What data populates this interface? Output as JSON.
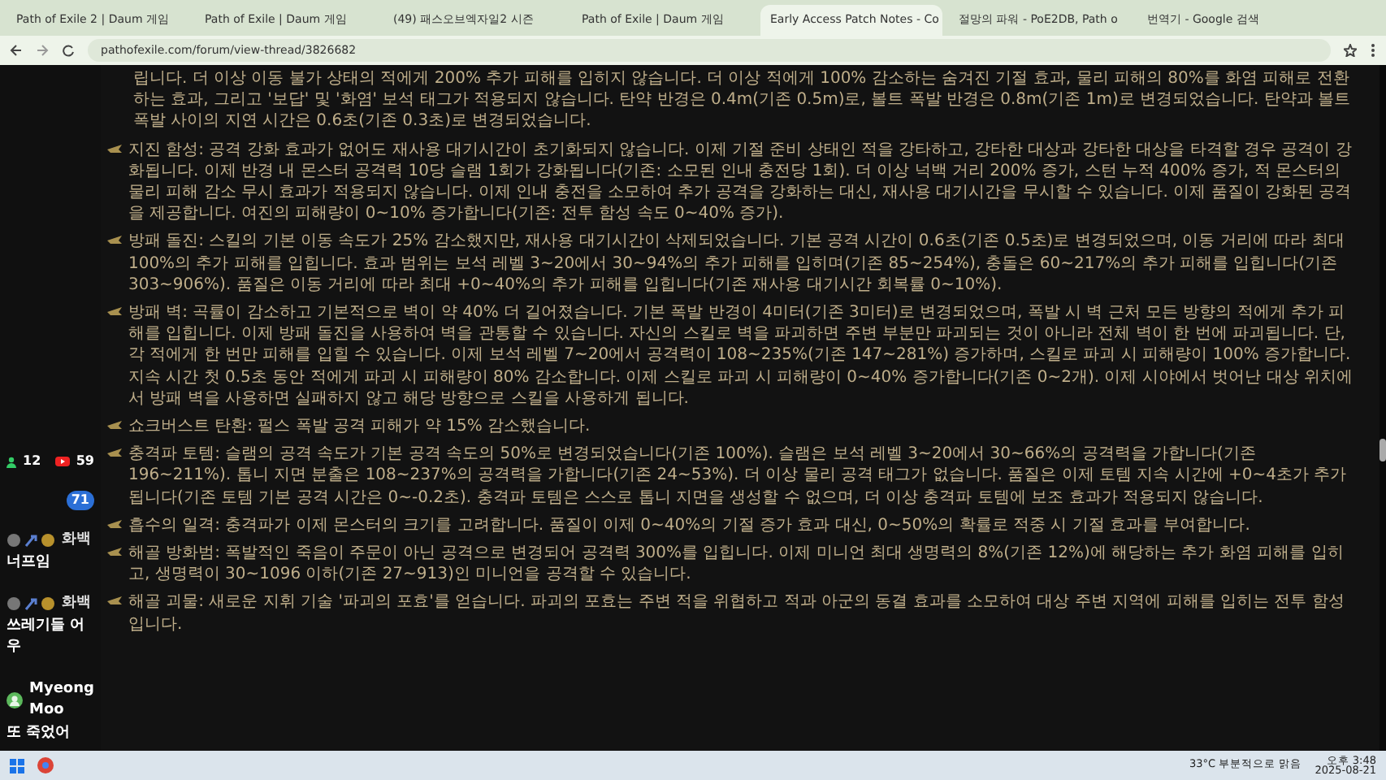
{
  "browser": {
    "tabs": [
      {
        "title": "Path of Exile 2 | Daum 게임",
        "selected": false
      },
      {
        "title": "Path of Exile | Daum 게임",
        "selected": false
      },
      {
        "title": "(49) 패스오브엑자일2 시즌",
        "selected": false
      },
      {
        "title": "Path of Exile | Daum 게임",
        "selected": false
      },
      {
        "title": "Early Access Patch Notes - Co",
        "selected": true
      },
      {
        "title": "절망의 파워 - PoE2DB, Path o",
        "selected": false
      },
      {
        "title": "번역기 - Google 검색",
        "selected": false
      }
    ],
    "url": "pathofexile.com/forum/view-thread/3826682"
  },
  "page": {
    "intro": "립니다. 더 이상 이동 불가 상태의 적에게 200% 추가 피해를 입히지 않습니다. 더 이상 적에게 100% 감소하는 숨겨진 기절 효과, 물리 피해의 80%를 화염 피해로 전환하는 효과, 그리고 '보답' 및 '화염' 보석 태그가 적용되지 않습니다. 탄약 반경은 0.4m(기존 0.5m)로, 볼트 폭발 반경은 0.8m(기존 1m)로 변경되었습니다. 탄약과 볼트 폭발 사이의 지연 시간은 0.6초(기존 0.3초)로 변경되었습니다.",
    "items": [
      {
        "text": "지진 함성: 공격 강화 효과가 없어도 재사용 대기시간이 초기화되지 않습니다. 이제 기절 준비 상태인 적을 강타하고, 강타한 대상과 강타한 대상을 타격할 경우 공격이 강화됩니다. 이제 반경 내 몬스터 공격력 10당 슬램 1회가 강화됩니다(기존: 소모된 인내 충전당 1회). 더 이상 넉백 거리 200% 증가, 스턴 누적 400% 증가, 적 몬스터의 물리 피해 감소 무시 효과가 적용되지 않습니다. 이제 인내 충전을 소모하여 추가 공격을 강화하는 대신, 재사용 대기시간을 무시할 수 있습니다. 이제 품질이 강화된 공격을 제공합니다. 여진의 피해량이 0~10% 증가합니다(기존: 전투 함성 속도 0~40% 증가)."
      },
      {
        "text": "방패 돌진: 스킬의 기본 이동 속도가 25% 감소했지만, 재사용 대기시간이 삭제되었습니다. 기본 공격 시간이 0.6초(기존 0.5초)로 변경되었으며, 이동 거리에 따라 최대 100%의 추가 피해를 입힙니다. 효과 범위는 보석 레벨 3~20에서 30~94%의 추가 피해를 입히며(기존 85~254%), 충돌은 60~217%의 추가 피해를 입힙니다(기존 303~906%). 품질은 이동 거리에 따라 최대 +0~40%의 추가 피해를 입힙니다(기존 재사용 대기시간 회복률 0~10%)."
      },
      {
        "text": "방패 벽: 곡률이 감소하고 기본적으로 벽이 약 40% 더 길어졌습니다. 기본 폭발 반경이 4미터(기존 3미터)로 변경되었으며, 폭발 시 벽 근처 모든 방향의 적에게 추가 피해를 입힙니다. 이제 방패 돌진을 사용하여 벽을 관통할 수 있습니다. 자신의 스킬로 벽을 파괴하면 주변 부분만 파괴되는 것이 아니라 전체 벽이 한 번에 파괴됩니다. 단, 각 적에게 한 번만 피해를 입힐 수 있습니다. 이제 보석 레벨 7~20에서 공격력이 108~235%(기존 147~281%) 증가하며, 스킬로 파괴 시 피해량이 100% 증가합니다. 지속 시간 첫 0.5초 동안 적에게 파괴 시 피해량이 80% 감소합니다. 이제 스킬로 파괴 시 피해량이 0~40% 증가합니다(기존 0~2개). 이제 시야에서 벗어난 대상 위치에서 방패 벽을 사용하면 실패하지 않고 해당 방향으로 스킬을 사용하게 됩니다."
      },
      {
        "text": "쇼크버스트 탄환: 펄스 폭발 공격 피해가 약 15% 감소했습니다."
      },
      {
        "text": "충격파 토템: 슬램의 공격 속도가 기본 공격 속도의 50%로 변경되었습니다(기존 100%). 슬램은 보석 레벨 3~20에서 30~66%의 공격력을 가합니다(기존 196~211%). 톱니 지면 분출은 108~237%의 공격력을 가합니다(기존 24~53%). 더 이상 물리 공격 태그가 없습니다. 품질은 이제 토템 지속 시간에 +0~4초가 추가됩니다(기존 토템 기본 공격 시간은 0~-0.2초). 충격파 토템은 스스로 톱니 지면을 생성할 수 없으며, 더 이상 충격파 토템에 보조 효과가 적용되지 않습니다."
      },
      {
        "text": "흡수의 일격: 충격파가 이제 몬스터의 크기를 고려합니다. 품질이 이제 0~40%의 기절 증가 효과 대신, 0~50%의 확률로 적중 시 기절 효과를 부여합니다."
      },
      {
        "text": "해골 방화범: 폭발적인 죽음이 주문이 아닌 공격으로 변경되어 공격력 300%를 입힙니다. 이제 미니언 최대 생명력의 8%(기존 12%)에 해당하는 추가 화염 피해를 입히고, 생명력이 30~1096 이하(기존 27~913)인 미니언을 공격할 수 있습니다."
      },
      {
        "text": "해골 괴물: 새로운 지휘 기술 '파괴의 포효'를 얻습니다. 파괴의 포효는 주변 적을 위협하고 적과 아군의 동결 효과를 소모하여 대상 주변 지역에 피해를 입히는 전투 함성입니다."
      }
    ]
  },
  "chat": {
    "counters": [
      {
        "kind": "viewers",
        "count": "12"
      },
      {
        "kind": "youtube",
        "count": "59"
      }
    ],
    "overlay_badge": "71",
    "messages": [
      {
        "kind": "badges",
        "user": "화백",
        "text": "너프임"
      },
      {
        "kind": "badges",
        "user": "화백",
        "text": "쓰레기들 어우"
      },
      {
        "kind": "avatar",
        "user": "Myeong Moo",
        "text": "또 죽었어"
      }
    ]
  },
  "taskbar": {
    "weather": "33°C 부분적으로 맑음",
    "time": "오후 3:48",
    "date": "2025-08-21"
  }
}
